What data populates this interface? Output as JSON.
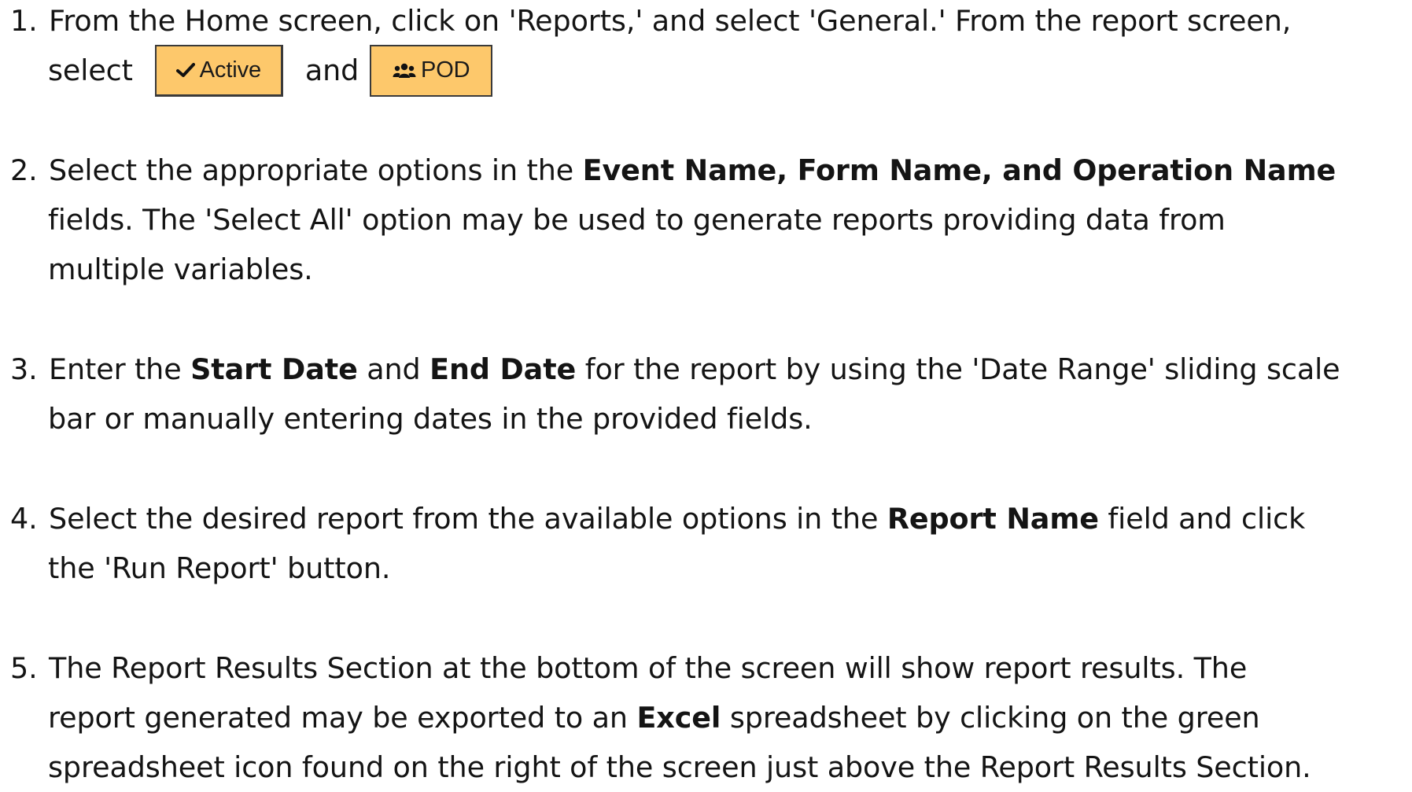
{
  "steps": [
    {
      "number": "1.",
      "line1": "From the Home screen, click on 'Reports,' and select 'General.'  From the report screen,",
      "line2_prefix": "select",
      "line2_conjunction": "and"
    },
    {
      "number": "2.",
      "line1_prefix": "Select the appropriate options in the ",
      "line1_bold": "Event Name, Form Name, and Operation Name",
      "line2": "fields.  The 'Select All' option may be used to generate reports providing data from",
      "line3": "multiple variables."
    },
    {
      "number": "3.",
      "line1_a": "Enter the ",
      "line1_bold1": "Start Date",
      "line1_b": " and ",
      "line1_bold2": "End Date",
      "line1_c": " for the report by using the 'Date Range' sliding scale",
      "line2": "bar or manually entering dates in the provided fields."
    },
    {
      "number": "4.",
      "line1_a": "Select the desired report from the available options in the ",
      "line1_bold": "Report Name",
      "line1_b": " field and click",
      "line2": "the 'Run Report' button."
    },
    {
      "number": "5.",
      "line1": "The Report Results Section at the bottom of the screen will show report results.  The",
      "line2_a": "report generated may be exported to an ",
      "line2_bold": "Excel",
      "line2_b": " spreadsheet by clicking on the green",
      "line3": "spreadsheet icon found on the right of the screen just above the Report Results Section."
    }
  ],
  "buttons": {
    "active": {
      "label": "Active",
      "icon": "checkmark-icon",
      "color": "#fdc86b"
    },
    "pod": {
      "label": "POD",
      "icon": "users-group-icon",
      "color": "#fdc86b"
    }
  }
}
